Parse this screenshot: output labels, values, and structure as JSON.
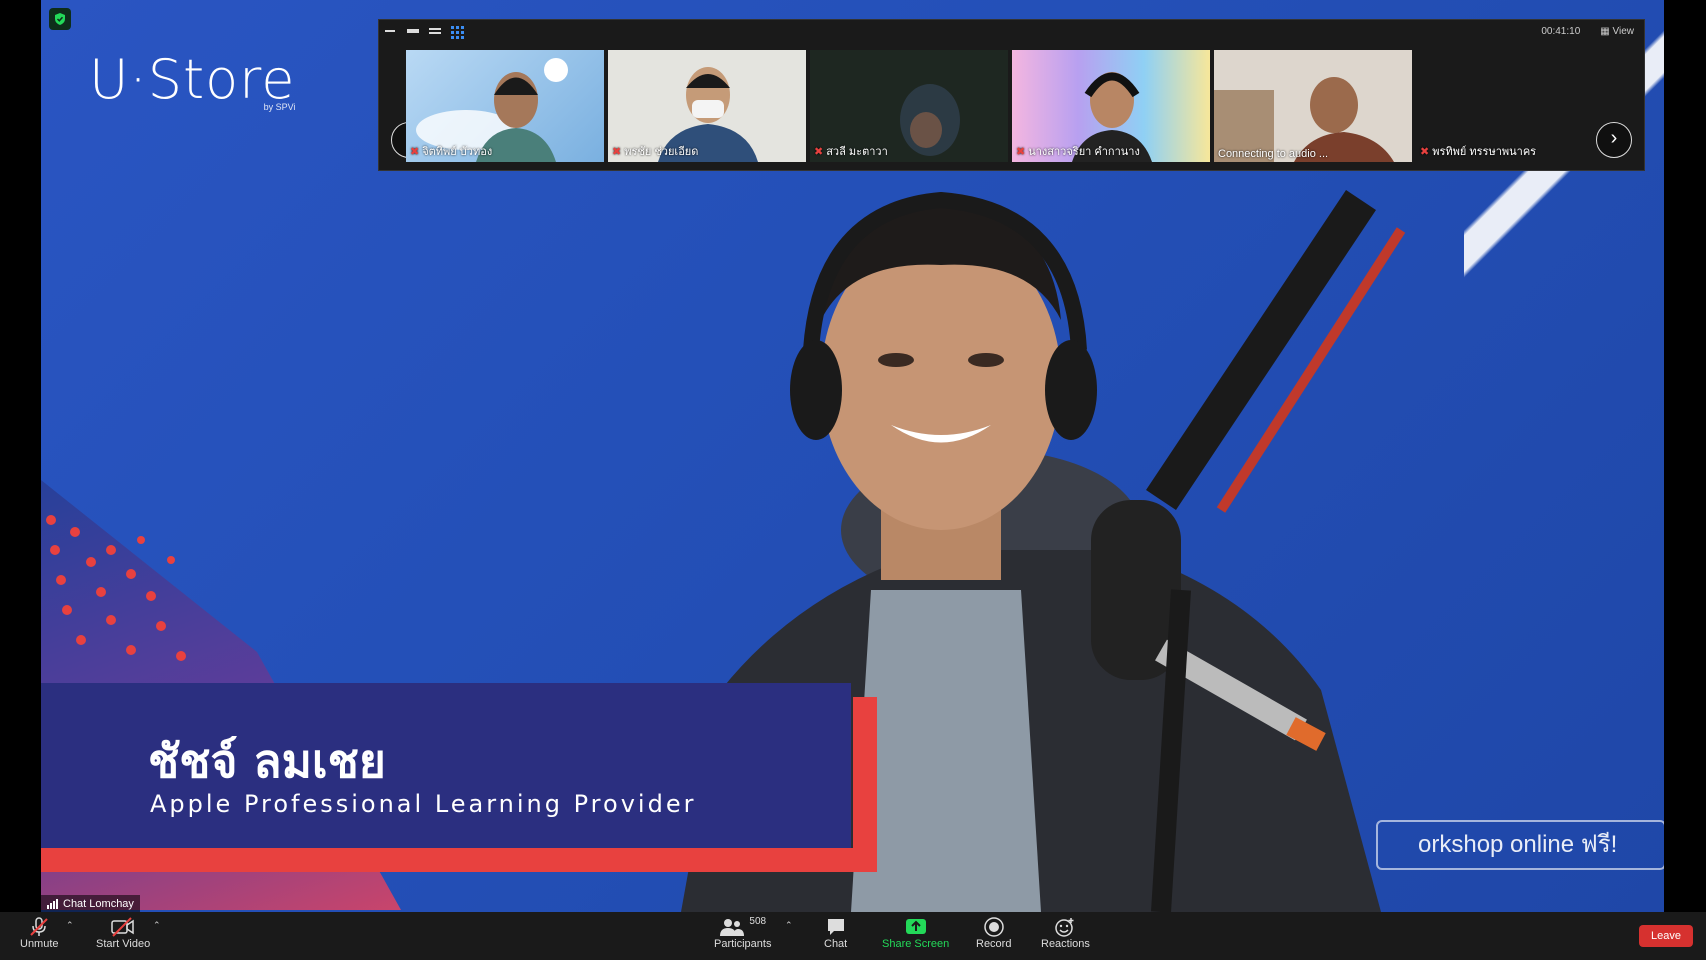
{
  "stage": {
    "logo": "U·Store",
    "logo_sub": "by SPVi",
    "speaker_name": "ชัชจ์ ลมเชย",
    "speaker_title": "Apple Professional Learning Provider",
    "workshop_tag": "orkshop online ฟรี!"
  },
  "gallery": {
    "top_right_time": "00:41:10",
    "view_label": "View",
    "tiles": [
      {
        "label": "จิตทิพย์ บัวทอง",
        "muted": true
      },
      {
        "label": "พรชัย ช่วยเอียด",
        "muted": true
      },
      {
        "label": "สวลี มะตาวา",
        "muted": true
      },
      {
        "label": "นางสาวจริยา คำกานาง",
        "muted": true
      },
      {
        "label": "Connecting to audio ...",
        "muted": false
      },
      {
        "label": "พรทิพย์ ทรรษาพนาคร",
        "muted": true
      }
    ]
  },
  "chat_indicator": "Chat Lomchay",
  "toolbar": {
    "unmute": "Unmute",
    "start_video": "Start Video",
    "participants": "Participants",
    "participants_count": "508",
    "chat": "Chat",
    "share_screen": "Share Screen",
    "record": "Record",
    "reactions": "Reactions",
    "leave": "Leave"
  },
  "colors": {
    "stage_blue": "#2450b8",
    "lower_third": "#2b2f80",
    "accent_red": "#e8413f",
    "share_green": "#23d959",
    "leave_red": "#d6312f",
    "gallery_active": "#3b8ef3"
  }
}
